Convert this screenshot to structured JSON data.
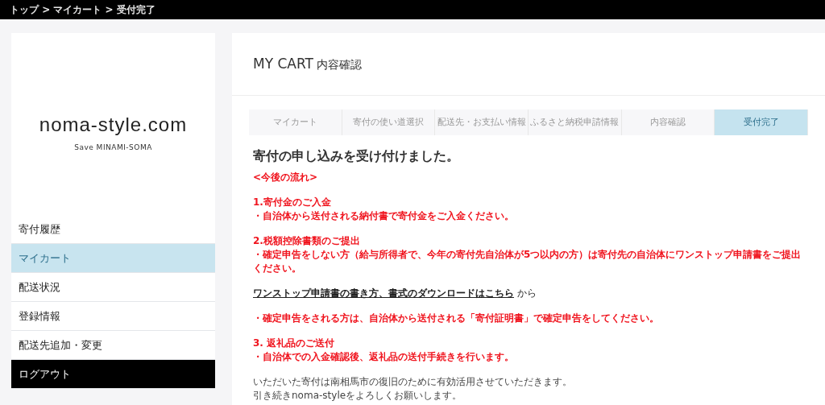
{
  "breadcrumb": "トップ > マイカート > 受付完了",
  "logo": {
    "title": "noma-style.com",
    "tagline": "Save MINAMI-SOMA"
  },
  "sidebar": {
    "items": [
      {
        "label": "寄付履歴",
        "selected": false,
        "kind": "link"
      },
      {
        "label": "マイカート",
        "selected": true,
        "kind": "link"
      },
      {
        "label": "配送状況",
        "selected": false,
        "kind": "link"
      },
      {
        "label": "登録情報",
        "selected": false,
        "kind": "link"
      },
      {
        "label": "配送先追加・変更",
        "selected": false,
        "kind": "link"
      },
      {
        "label": "ログアウト",
        "selected": false,
        "kind": "logout"
      }
    ]
  },
  "page_title": {
    "main": "MY CART",
    "sub": "内容確認"
  },
  "steps": [
    {
      "label": "マイカート",
      "selected": false
    },
    {
      "label": "寄付の使い道選択",
      "selected": false
    },
    {
      "label": "配送先・お支払い情報",
      "selected": false
    },
    {
      "label": "ふるさと納税申請情報",
      "selected": false
    },
    {
      "label": "内容確認",
      "selected": false
    },
    {
      "label": "受付完了",
      "selected": true
    }
  ],
  "heading": "寄付の申し込みを受け付けました。",
  "blocks": [
    {
      "kind": "notice",
      "lines": [
        "<今後の流れ>"
      ]
    },
    {
      "kind": "notice",
      "lines": [
        "1.寄付金のご入金",
        "・自治体から送付される納付書で寄付金をご入金ください。"
      ]
    },
    {
      "kind": "notice",
      "lines": [
        "2.税額控除書類のご提出",
        "・確定申告をしない方（給与所得者で、今年の寄付先自治体が5つ以内の方）は寄付先の自治体にワンストップ申請書をご提出ください。"
      ]
    },
    {
      "kind": "link",
      "link": "ワンストップ申請書の書き方、書式のダウンロードはこちら",
      "suffix": "から"
    },
    {
      "kind": "notice",
      "lines": [
        "・確定申告をされる方は、自治体から送付される「寄付証明書」で確定申告をしてください。"
      ]
    },
    {
      "kind": "notice",
      "lines": [
        "3. 返礼品のご送付",
        "・自治体での入金確認後、返礼品の送付手続きを行います。"
      ]
    },
    {
      "kind": "plain",
      "lines": [
        "いただいた寄付は南相馬市の復旧のために有効活用させていただきます。",
        "引き続きnoma-styleをよろしくお願いします。"
      ]
    }
  ]
}
